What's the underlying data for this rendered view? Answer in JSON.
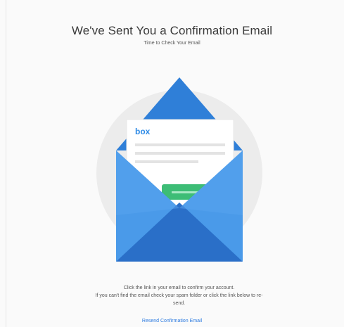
{
  "page": {
    "title": "We've Sent You a Confirmation Email",
    "subtitle": "Time to Check Your Email"
  },
  "illustration": {
    "logo_text": "box",
    "colors": {
      "circle": "#ececec",
      "envelope_dark": "#2a74cf",
      "envelope_mid": "#3d8fe3",
      "envelope_light": "#5aa6ef",
      "card": "#ffffff",
      "lines": "#e3e3e3",
      "button": "#3dbd76",
      "logo": "#2d8ae6"
    }
  },
  "instructions": {
    "line1": "Click the link in your email to confirm your account.",
    "line2": "If you can't find the email check your spam folder or click the link below to re-",
    "line3": "send."
  },
  "resend": {
    "label": "Resend Confirmation Email"
  }
}
